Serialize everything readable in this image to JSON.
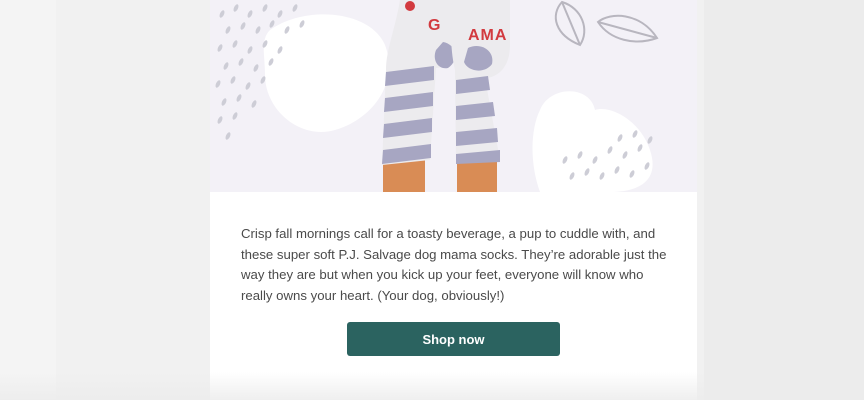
{
  "hero": {
    "sock_left_text": "G",
    "sock_right_text": "AMA",
    "colors": {
      "background": "#f3f1f7",
      "stripe_gray": "#a7a6c2",
      "stripe_cream": "#ecebee",
      "lettering_red": "#d23a3f",
      "skin": "#d98c55",
      "confetti": "#cdcdd6"
    }
  },
  "body": {
    "paragraph": "Crisp fall mornings call for a toasty beverage, a pup to cuddle with, and these super soft P.J. Salvage dog mama socks. They’re adorable just the way they are but when you kick up your feet, everyone will know who really owns your heart. (Your dog, obviously!)"
  },
  "cta": {
    "label": "Shop now",
    "color": "#2b6360"
  }
}
